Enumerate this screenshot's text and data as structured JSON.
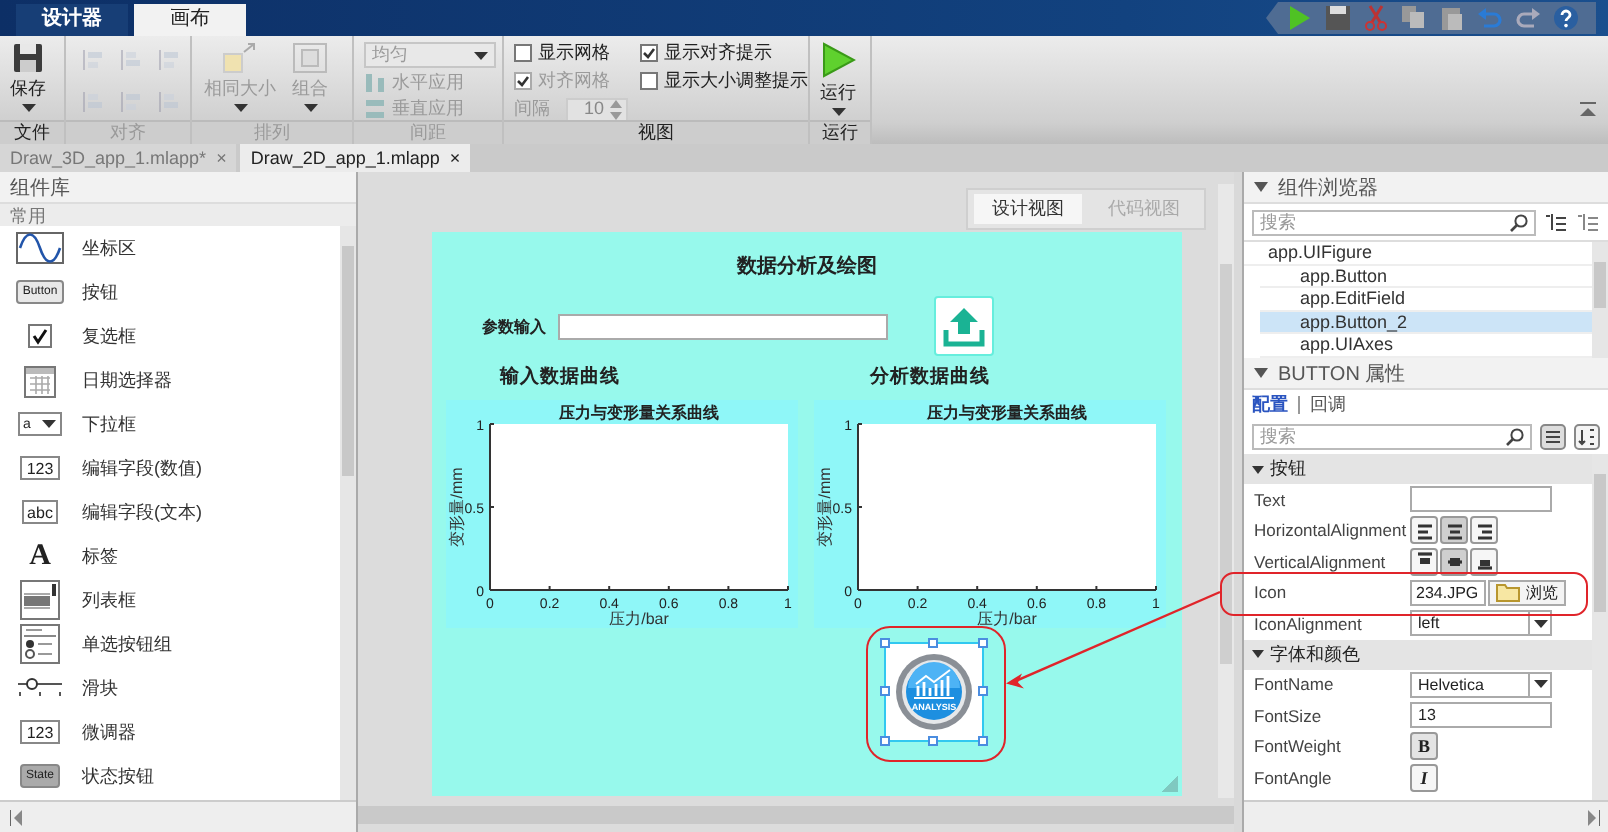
{
  "title_bar": {
    "tabs": [
      {
        "label": "设计器",
        "selected": false
      },
      {
        "label": "画布",
        "selected": true
      }
    ]
  },
  "ribbon": {
    "groups": [
      {
        "label": "文件",
        "kind": "file",
        "disabled": false,
        "button": "保存"
      },
      {
        "label": "对齐",
        "kind": "align",
        "disabled": true
      },
      {
        "label": "排列",
        "kind": "arrange",
        "disabled": true,
        "buttons": [
          "相同大小",
          "组合"
        ]
      },
      {
        "label": "间距",
        "kind": "spacing",
        "disabled": true,
        "dropdown": "均匀",
        "buttons": [
          "水平应用",
          "垂直应用"
        ]
      },
      {
        "label": "视图",
        "kind": "view",
        "disabled": false,
        "checks": [
          {
            "label": "显示网格",
            "checked": false,
            "disabled": false
          },
          {
            "label": "对齐网格",
            "checked": true,
            "disabled": true
          },
          {
            "label": "显示对齐提示",
            "checked": true,
            "disabled": false
          },
          {
            "label": "显示大小调整提示",
            "checked": false,
            "disabled": false
          }
        ],
        "interval_label": "间隔",
        "interval_value": "10"
      },
      {
        "label": "运行",
        "kind": "run",
        "disabled": false,
        "button": "运行"
      }
    ]
  },
  "doc_tabs": [
    {
      "label": "Draw_3D_app_1.mlapp*",
      "close": "×",
      "selected": false
    },
    {
      "label": "Draw_2D_app_1.mlapp",
      "close": "×",
      "selected": true
    }
  ],
  "library": {
    "title": "组件库",
    "section": "常用",
    "items": [
      {
        "label": "坐标区",
        "kind": "axes"
      },
      {
        "label": "按钮",
        "kind": "button",
        "icon_text": "Button"
      },
      {
        "label": "复选框",
        "kind": "checkbox"
      },
      {
        "label": "日期选择器",
        "kind": "date"
      },
      {
        "label": "下拉框",
        "kind": "dropdown",
        "icon_text": "a"
      },
      {
        "label": "编辑字段(数值)",
        "kind": "field",
        "icon_text": "123"
      },
      {
        "label": "编辑字段(文本)",
        "kind": "field",
        "icon_text": "abc"
      },
      {
        "label": "标签",
        "kind": "label",
        "icon_text": "A"
      },
      {
        "label": "列表框",
        "kind": "listbox"
      },
      {
        "label": "单选按钮组",
        "kind": "radiogroup"
      },
      {
        "label": "滑块",
        "kind": "slider"
      },
      {
        "label": "微调器",
        "kind": "spinner",
        "icon_text": "123"
      },
      {
        "label": "状态按钮",
        "kind": "statebutton",
        "icon_text": "State"
      }
    ]
  },
  "view_toggle": [
    {
      "label": "设计视图",
      "selected": true
    },
    {
      "label": "代码视图",
      "selected": false
    }
  ],
  "canvas": {
    "title": "数据分析及绘图",
    "field_label": "参数输入",
    "left_heading": "输入数据曲线",
    "right_heading": "分析数据曲线",
    "axes": [
      {
        "chart_data": {
          "type": "line",
          "title": "压力与变形量关系曲线",
          "xlabel": "压力/bar",
          "ylabel": "变形量/mm",
          "xlim": [
            0,
            1
          ],
          "ylim": [
            0,
            1
          ],
          "xticks": [
            0,
            0.2,
            0.4,
            0.6,
            0.8,
            1
          ],
          "yticks": [
            0,
            0.5,
            1
          ]
        }
      },
      {
        "chart_data": {
          "type": "line",
          "title": "压力与变形量关系曲线",
          "xlabel": "压力/bar",
          "ylabel": "变形量/mm",
          "xlim": [
            0,
            1
          ],
          "ylim": [
            0,
            1
          ],
          "xticks": [
            0,
            0.2,
            0.4,
            0.6,
            0.8,
            1
          ],
          "yticks": [
            0,
            0.5,
            1
          ]
        }
      }
    ],
    "image_button": {
      "text": "ANALYSIS",
      "selected": true,
      "highlighted": true
    }
  },
  "browser": {
    "title": "组件浏览器",
    "search_placeholder": "搜索",
    "tree": [
      {
        "label": "app.UIFigure",
        "selected": false,
        "children": [
          {
            "label": "app.Button",
            "selected": false
          },
          {
            "label": "app.EditField",
            "selected": false
          },
          {
            "label": "app.Button_2",
            "selected": true
          },
          {
            "label": "app.UIAxes",
            "selected": false
          }
        ]
      }
    ]
  },
  "properties": {
    "title": "BUTTON 属性",
    "tabs": [
      {
        "label": "配置",
        "selected": true
      },
      {
        "label": "回调",
        "selected": false
      }
    ],
    "search_placeholder": "搜索",
    "sections": [
      {
        "title": "按钮",
        "rows": [
          {
            "name": "Text",
            "kind": "text",
            "highlighted": false
          },
          {
            "name": "HorizontalAlignment",
            "kind": "align",
            "highlighted": false,
            "options": [
              {
                "selected": false
              },
              {
                "selected": true
              },
              {
                "selected": false
              }
            ]
          },
          {
            "name": "VerticalAlignment",
            "kind": "valign",
            "highlighted": false,
            "options": [
              {
                "selected": false
              },
              {
                "selected": true
              },
              {
                "selected": false
              }
            ]
          },
          {
            "name": "Icon",
            "kind": "file",
            "value": "234.JPG",
            "button": "浏览",
            "highlighted": true
          },
          {
            "name": "IconAlignment",
            "kind": "dropdown",
            "value": "left",
            "highlighted": false
          }
        ]
      },
      {
        "title": "字体和颜色",
        "rows": [
          {
            "name": "FontName",
            "kind": "dropdown",
            "value": "Helvetica",
            "highlighted": false
          },
          {
            "name": "FontSize",
            "kind": "text",
            "value": "13",
            "highlighted": false
          },
          {
            "name": "FontWeight",
            "kind": "toggle",
            "glyph": "B",
            "highlighted": false
          },
          {
            "name": "FontAngle",
            "kind": "toggle",
            "glyph": "I",
            "highlighted": false
          }
        ]
      }
    ]
  }
}
